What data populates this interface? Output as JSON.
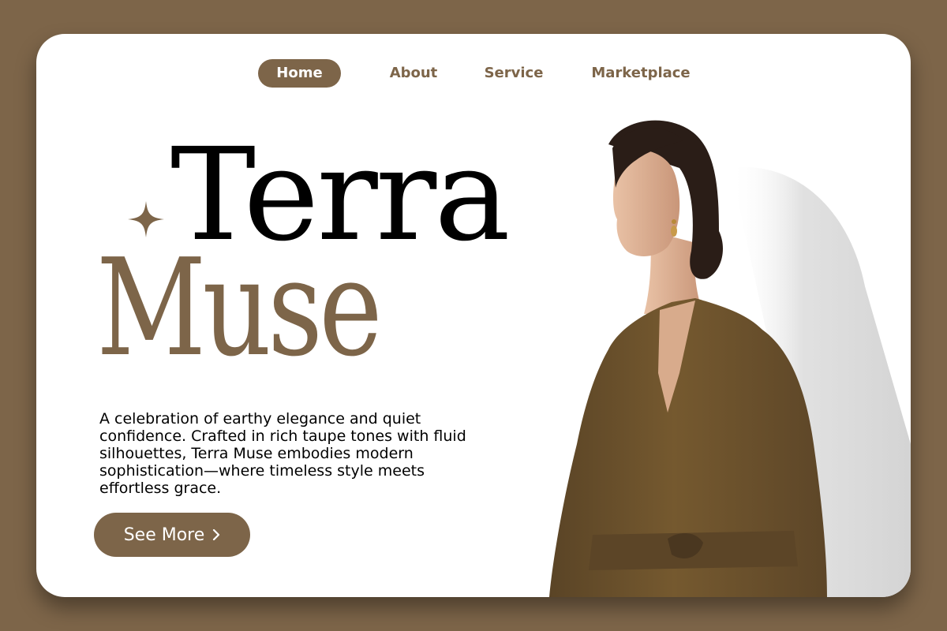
{
  "nav": {
    "items": [
      {
        "label": "Home",
        "active": true
      },
      {
        "label": "About",
        "active": false
      },
      {
        "label": "Service",
        "active": false
      },
      {
        "label": "Marketplace",
        "active": false
      }
    ]
  },
  "hero": {
    "title_line1": "Terra",
    "title_line2": "Muse",
    "description": "A celebration of earthy elegance and quiet confidence. Crafted in rich taupe tones with fluid silhouettes, Terra Muse embodies modern sophistication—where timeless style meets effortless grace.",
    "cta_label": "See More"
  },
  "icons": {
    "sparkle": "sparkle-icon",
    "cta_arrow": "chevron-right-icon"
  },
  "colors": {
    "background": "#7d6549",
    "card": "#ffffff",
    "accent": "#7d6549",
    "title_dark": "#000000",
    "dress": "#6f5530"
  }
}
